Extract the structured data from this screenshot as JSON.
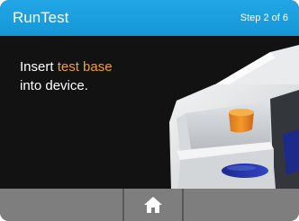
{
  "header": {
    "title": "RunTest",
    "step_label": "Step 2 of 6"
  },
  "instruction": {
    "line1_prefix": "Insert ",
    "line1_highlight": "test base",
    "line2": "into device."
  },
  "nav": {
    "home_icon": "home-icon"
  },
  "colors": {
    "header": "#1f9fe0",
    "highlight": "#f4a12a",
    "background": "#141414",
    "nav": "#7a7a7a"
  }
}
